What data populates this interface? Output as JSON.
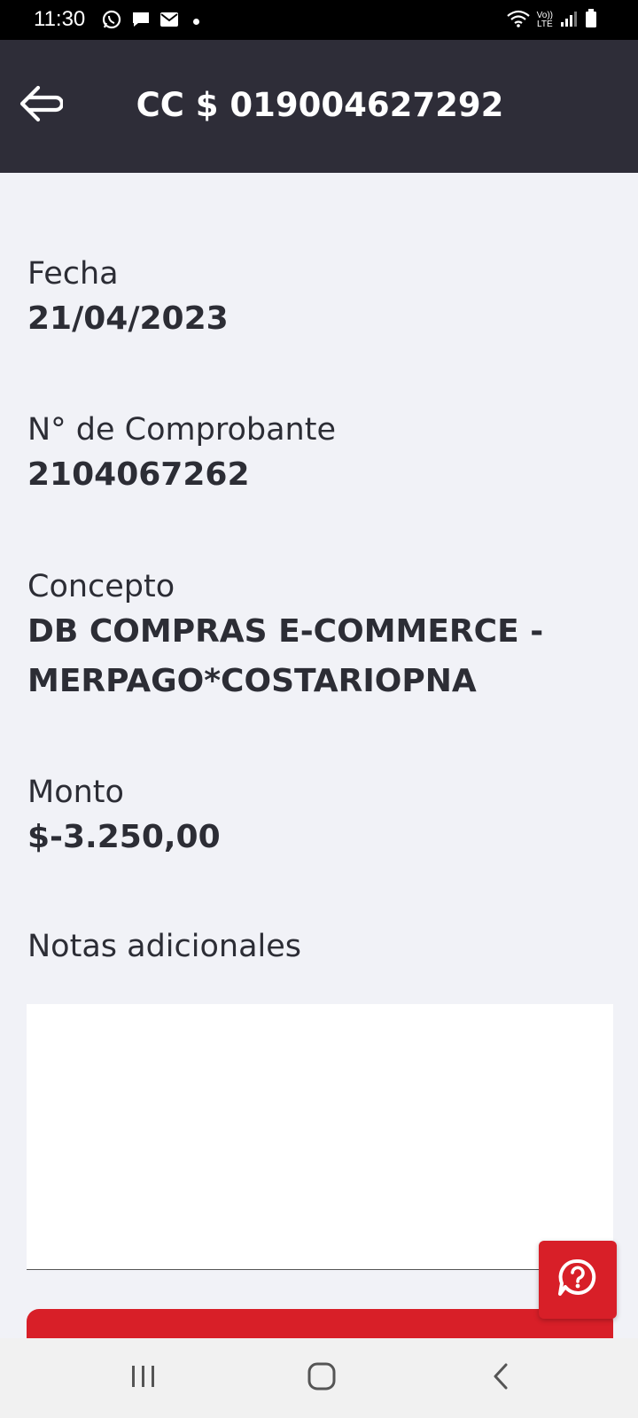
{
  "status_bar": {
    "time": "11:30",
    "left_icons": [
      "whatsapp-icon",
      "message-icon",
      "mail-icon",
      "dot-icon"
    ],
    "right_icons": [
      "wifi-icon",
      "volte-icon",
      "signal-icon",
      "battery-icon"
    ],
    "volte_top": "Vo))",
    "volte_bottom": "LTE"
  },
  "header": {
    "title": "CC $ 019004627292",
    "back_icon": "back-arrow-icon",
    "background": "#2e2d38"
  },
  "details": {
    "fecha_label": "Fecha",
    "fecha_value": "21/04/2023",
    "comprobante_label": "N° de Comprobante",
    "comprobante_value": "2104067262",
    "concepto_label": "Concepto",
    "concepto_line1": "DB COMPRAS E-COMMERCE -",
    "concepto_line2": "MERPAGO*COSTARIOPNA",
    "monto_label": "Monto",
    "monto_value": "$-3.250,00",
    "notas_label": "Notas adicionales",
    "notas_value": ""
  },
  "help_button": {
    "icon": "help-chat-icon"
  },
  "accent_color": "#d81f28",
  "nav_bar": {
    "icons": [
      "recent-apps-icon",
      "home-icon",
      "back-icon"
    ]
  }
}
